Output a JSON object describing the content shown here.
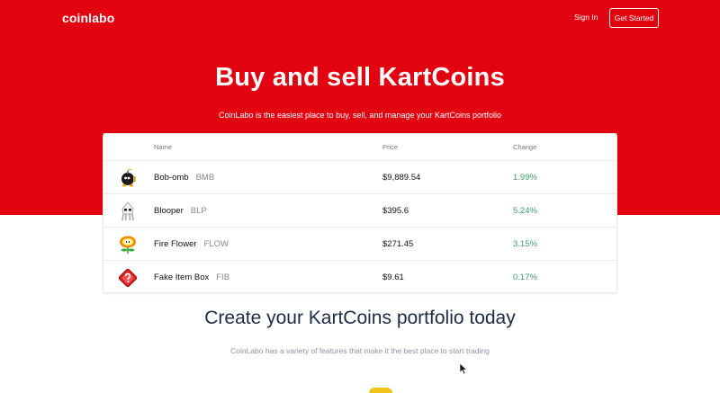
{
  "nav": {
    "logo": "coinlabo",
    "signin": "Sign In",
    "cta": "Get Started"
  },
  "hero": {
    "title": "Buy and sell KartCoins",
    "subtitle": "CoinLabo is the easiest place to buy, sell, and manage your KartCoins portfolio"
  },
  "table": {
    "headers": {
      "name": "Name",
      "price": "Price",
      "change": "Change"
    },
    "rows": [
      {
        "icon": "bob-omb-icon",
        "name": "Bob-omb",
        "symbol": "BMB",
        "price": "$9,889.54",
        "change": "1.99%"
      },
      {
        "icon": "blooper-icon",
        "name": "Blooper",
        "symbol": "BLP",
        "price": "$395.6",
        "change": "5.24%"
      },
      {
        "icon": "fire-flower-icon",
        "name": "Fire Flower",
        "symbol": "FLOW",
        "price": "$271.45",
        "change": "3.15%"
      },
      {
        "icon": "fake-item-box-icon",
        "name": "Fake Item Box",
        "symbol": "FIB",
        "price": "$9.61",
        "change": "0.17%"
      }
    ]
  },
  "features": {
    "title": "Create your KartCoins portfolio today",
    "subtitle": "CoinLabo has a variety of features that make it the best place to start trading"
  },
  "colors": {
    "brand_red": "#e3020f",
    "positive_green": "#3e9a6e",
    "heading_navy": "#1d2b45"
  }
}
